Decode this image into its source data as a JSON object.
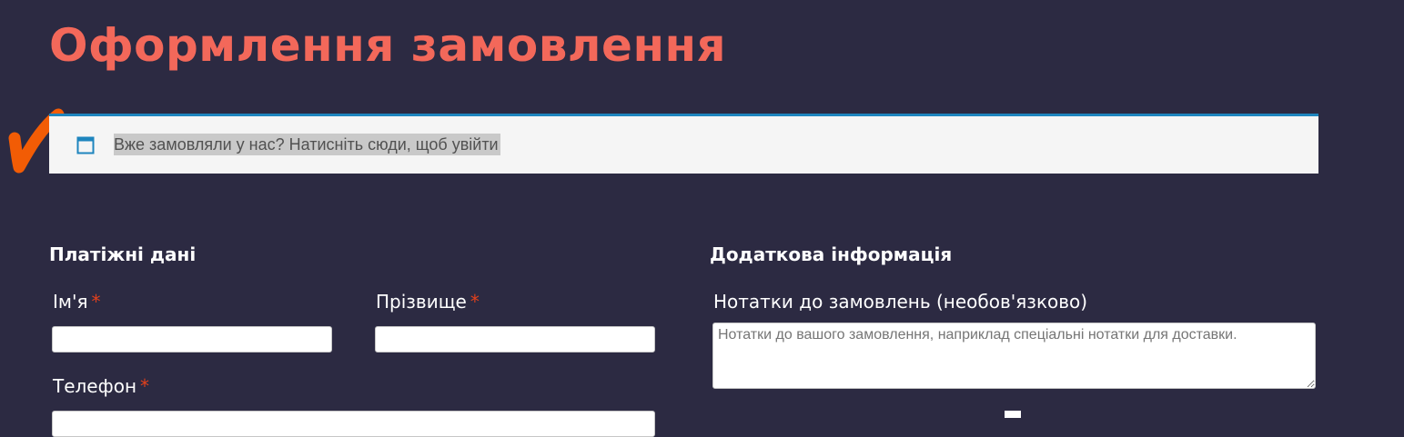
{
  "page": {
    "title": "Оформлення замовлення"
  },
  "login_notice": {
    "icon": "window-icon",
    "text": "Вже замовляли у нас? Натисніть сюди, щоб увійти",
    "accent_color": "#1e85be"
  },
  "billing": {
    "heading": "Платіжні дані",
    "first_name": {
      "label": "Ім'я",
      "required_mark": "*",
      "value": ""
    },
    "last_name": {
      "label": "Прізвище",
      "required_mark": "*",
      "value": ""
    },
    "phone": {
      "label": "Телефон",
      "required_mark": "*",
      "value": ""
    }
  },
  "additional": {
    "heading": "Додаткова інформація",
    "notes": {
      "label": "Нотатки до замовлень (необов'язково)",
      "placeholder": "Нотатки до вашого замовлення, наприклад спеціальні нотатки для доставки.",
      "value": ""
    }
  },
  "colors": {
    "background": "#2c2a42",
    "title": "#f3685a",
    "checkmark": "#f25c05",
    "required": "#e2401c"
  }
}
